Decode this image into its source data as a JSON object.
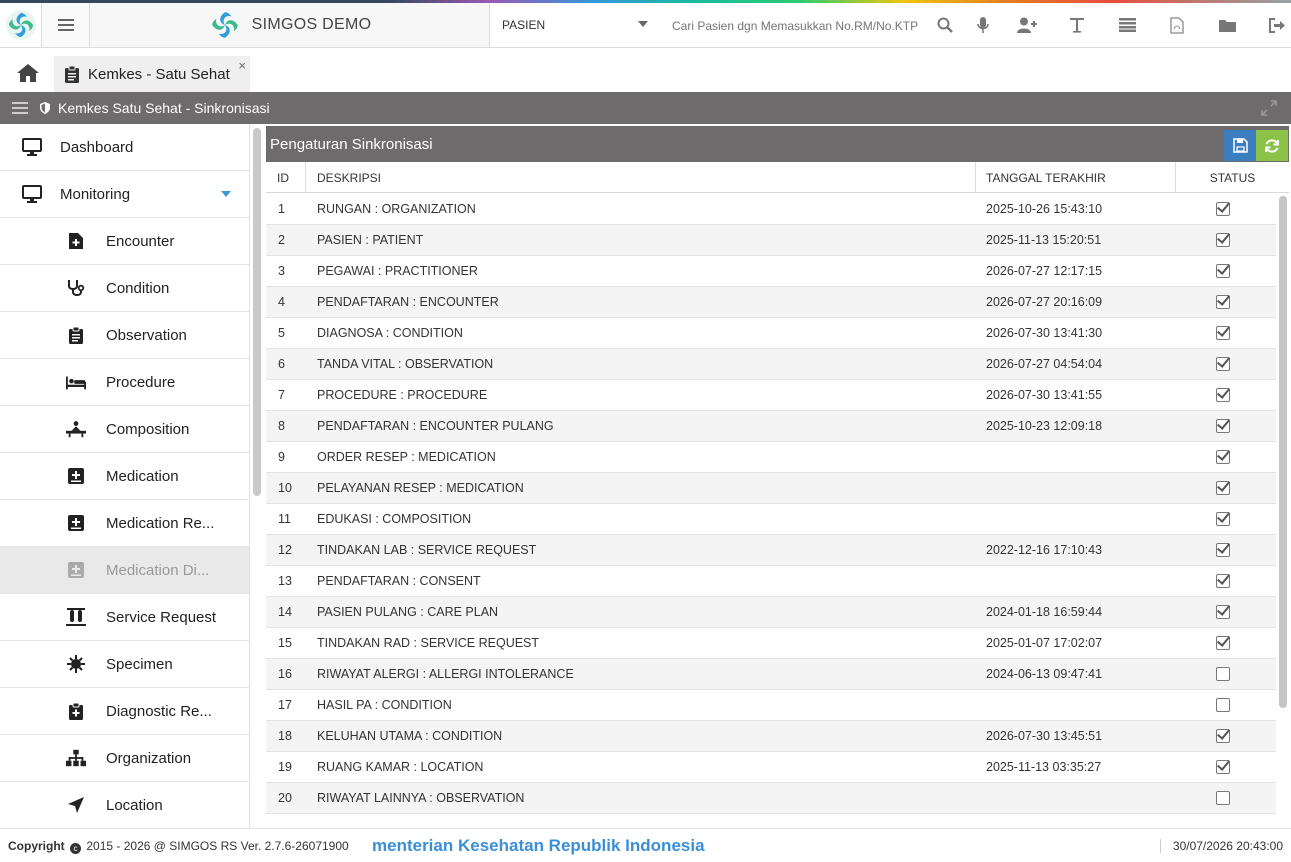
{
  "app": {
    "brand": "SIMGOS DEMO",
    "colors": {
      "accent": "#3c7fc1",
      "refresh": "#8bc34a",
      "header_bar": "#6d6b6b",
      "marquee": "#3a8fd8"
    }
  },
  "topbar": {
    "select_value": "PASIEN",
    "search_placeholder": "Cari Pasien dgn Memasukkan No.RM/No.KTP",
    "icons": [
      "search-icon",
      "microphone-icon",
      "add-user-icon",
      "text-icon",
      "list-icon",
      "pdf-file-icon",
      "folder-icon",
      "logout-icon"
    ]
  },
  "tabs": [
    {
      "label": "Kemkes - Satu Sehat",
      "close": "×"
    }
  ],
  "panel": {
    "title": "Kemkes Satu Sehat - Sinkronisasi"
  },
  "sidebar": {
    "items": [
      {
        "label": "Dashboard",
        "icon": "monitor-icon",
        "level": "top"
      },
      {
        "label": "Monitoring",
        "icon": "monitor-icon",
        "level": "top",
        "expanded": true
      },
      {
        "label": "Encounter",
        "icon": "file-plus-icon",
        "level": "sub"
      },
      {
        "label": "Condition",
        "icon": "stethoscope-icon",
        "level": "sub"
      },
      {
        "label": "Observation",
        "icon": "clipboard-icon",
        "level": "sub"
      },
      {
        "label": "Procedure",
        "icon": "bed-icon",
        "level": "sub"
      },
      {
        "label": "Composition",
        "icon": "procedure-icon",
        "level": "sub"
      },
      {
        "label": "Medication",
        "icon": "medical-box-icon",
        "level": "sub"
      },
      {
        "label": "Medication Re...",
        "icon": "medical-box-icon",
        "level": "sub"
      },
      {
        "label": "Medication Di...",
        "icon": "medical-box-icon",
        "level": "sub",
        "active": true
      },
      {
        "label": "Service Request",
        "icon": "test-tubes-icon",
        "level": "sub"
      },
      {
        "label": "Specimen",
        "icon": "virus-icon",
        "level": "sub"
      },
      {
        "label": "Diagnostic Re...",
        "icon": "clipboard-plus-icon",
        "level": "sub"
      },
      {
        "label": "Organization",
        "icon": "sitemap-icon",
        "level": "sub"
      },
      {
        "label": "Location",
        "icon": "location-arrow-icon",
        "level": "sub"
      }
    ]
  },
  "content": {
    "title": "Pengaturan Sinkronisasi",
    "columns": {
      "id": "ID",
      "desc": "DESKRIPSI",
      "date": "TANGGAL TERAKHIR",
      "status": "STATUS"
    },
    "rows": [
      {
        "id": "1",
        "desc": "RUNGAN : ORGANIZATION",
        "date": "2025-10-26 15:43:10",
        "status": true
      },
      {
        "id": "2",
        "desc": "PASIEN : PATIENT",
        "date": "2025-11-13 15:20:51",
        "status": true
      },
      {
        "id": "3",
        "desc": "PEGAWAI : PRACTITIONER",
        "date": "2026-07-27 12:17:15",
        "status": true
      },
      {
        "id": "4",
        "desc": "PENDAFTARAN : ENCOUNTER",
        "date": "2026-07-27 20:16:09",
        "status": true
      },
      {
        "id": "5",
        "desc": "DIAGNOSA : CONDITION",
        "date": "2026-07-30 13:41:30",
        "status": true
      },
      {
        "id": "6",
        "desc": "TANDA VITAL : OBSERVATION",
        "date": "2026-07-27 04:54:04",
        "status": true
      },
      {
        "id": "7",
        "desc": "PROCEDURE : PROCEDURE",
        "date": "2026-07-30 13:41:55",
        "status": true
      },
      {
        "id": "8",
        "desc": "PENDAFTARAN : ENCOUNTER PULANG",
        "date": "2025-10-23 12:09:18",
        "status": true
      },
      {
        "id": "9",
        "desc": "ORDER RESEP : MEDICATION",
        "date": "",
        "status": true
      },
      {
        "id": "10",
        "desc": "PELAYANAN RESEP : MEDICATION",
        "date": "",
        "status": true
      },
      {
        "id": "11",
        "desc": "EDUKASI : COMPOSITION",
        "date": "",
        "status": true
      },
      {
        "id": "12",
        "desc": "TINDAKAN LAB : SERVICE REQUEST",
        "date": "2022-12-16 17:10:43",
        "status": true
      },
      {
        "id": "13",
        "desc": "PENDAFTARAN : CONSENT",
        "date": "",
        "status": true
      },
      {
        "id": "14",
        "desc": "PASIEN PULANG : CARE PLAN",
        "date": "2024-01-18 16:59:44",
        "status": true
      },
      {
        "id": "15",
        "desc": "TINDAKAN RAD : SERVICE REQUEST",
        "date": "2025-01-07 17:02:07",
        "status": true
      },
      {
        "id": "16",
        "desc": "RIWAYAT ALERGI : ALLERGI INTOLERANCE",
        "date": "2024-06-13 09:47:41",
        "status": false
      },
      {
        "id": "17",
        "desc": "HASIL PA : CONDITION",
        "date": "",
        "status": false
      },
      {
        "id": "18",
        "desc": "KELUHAN UTAMA : CONDITION",
        "date": "2026-07-30 13:45:51",
        "status": true
      },
      {
        "id": "19",
        "desc": "RUANG KAMAR : LOCATION",
        "date": "2025-11-13 03:35:27",
        "status": true
      },
      {
        "id": "20",
        "desc": "RIWAYAT LAINNYA : OBSERVATION",
        "date": "",
        "status": false
      }
    ]
  },
  "footer": {
    "copyright_label": "Copyright",
    "copyright_text": "2015 - 2026 @ SIMGOS RS Ver. 2.7.6-26071900",
    "marquee": "menterian Kesehatan Republik Indonesia",
    "datetime": "30/07/2026 20:43:00"
  }
}
